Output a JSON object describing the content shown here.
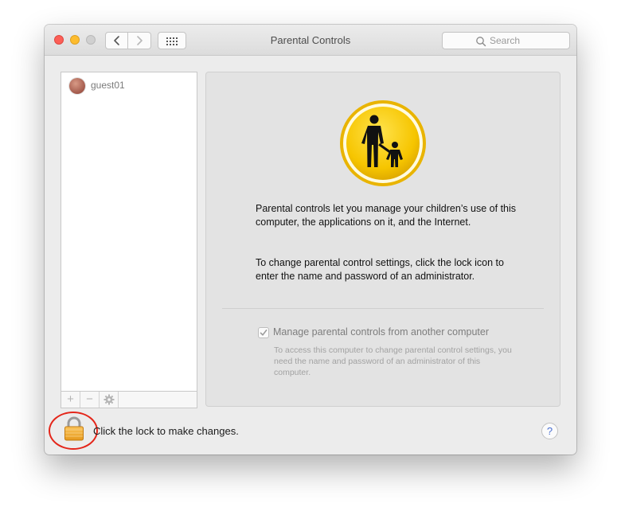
{
  "window": {
    "title": "Parental Controls",
    "search_placeholder": "Search"
  },
  "users": [
    {
      "name": "guest01"
    }
  ],
  "list_toolbar": {
    "add_label": "+",
    "remove_label": "−"
  },
  "main": {
    "intro_text": "Parental controls let you manage your children’s use of this computer, the applications on it, and the Internet.",
    "lock_instruction": "To change parental control settings, click the lock icon to enter the name and password of an administrator.",
    "remote_checkbox": {
      "label": "Manage parental controls from another computer",
      "checked": true,
      "enabled": false,
      "description": "To access this computer to change parental control settings, you need the name and password of an administrator of this computer."
    }
  },
  "footer": {
    "lock_text": "Click the lock to make changes.",
    "help_label": "?"
  },
  "icons": {
    "back": "chevron-left-icon",
    "forward": "chevron-right-icon",
    "grid": "grid-icon",
    "search": "magnifier-icon",
    "gear": "gear-icon",
    "parental": "parental-controls-icon",
    "lock": "lock-icon"
  },
  "colors": {
    "close": "#fc5f57",
    "minimize": "#fdbc2e",
    "zoom_disabled": "#d0d0d0",
    "parental_icon_yellow": "#f5c400",
    "highlight_ring": "#e4261a",
    "help_accent": "#4a6fd1"
  }
}
